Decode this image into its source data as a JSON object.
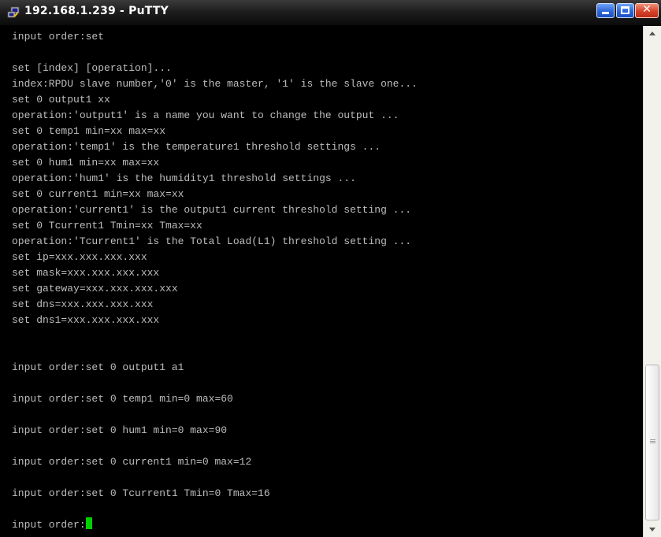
{
  "window": {
    "title": "192.168.1.239 - PuTTY",
    "icon": "putty-icon",
    "controls": [
      "minimize",
      "maximize",
      "close"
    ]
  },
  "colors": {
    "terminal_background": "#000000",
    "terminal_text": "#bdbdbd",
    "cursor": "#00d000"
  },
  "terminal": {
    "lines": [
      "input order:set",
      "",
      "set [index] [operation]...",
      "index:RPDU slave number,'0' is the master, '1' is the slave one...",
      "set 0 output1 xx",
      "operation:'output1' is a name you want to change the output ...",
      "set 0 temp1 min=xx max=xx",
      "operation:'temp1' is the temperature1 threshold settings ...",
      "set 0 hum1 min=xx max=xx",
      "operation:'hum1' is the humidity1 threshold settings ...",
      "set 0 current1 min=xx max=xx",
      "operation:'current1' is the output1 current threshold setting ...",
      "set 0 Tcurrent1 Tmin=xx Tmax=xx",
      "operation:'Tcurrent1' is the Total Load(L1) threshold setting ...",
      "set ip=xxx.xxx.xxx.xxx",
      "set mask=xxx.xxx.xxx.xxx",
      "set gateway=xxx.xxx.xxx.xxx",
      "set dns=xxx.xxx.xxx.xxx",
      "set dns1=xxx.xxx.xxx.xxx",
      "",
      "",
      "input order:set 0 output1 a1",
      "",
      "input order:set 0 temp1 min=0 max=60",
      "",
      "input order:set 0 hum1 min=0 max=90",
      "",
      "input order:set 0 current1 min=0 max=12",
      "",
      "input order:set 0 Tcurrent1 Tmin=0 Tmax=16",
      "",
      "input order:"
    ]
  },
  "scrollbar": {
    "up_icon": "scroll-up-arrow-icon",
    "down_icon": "scroll-down-arrow-icon",
    "position_fraction": 0.67
  }
}
